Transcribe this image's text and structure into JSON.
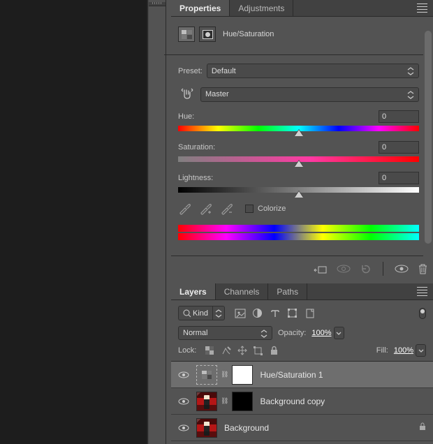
{
  "propertiesPanel": {
    "tabs": {
      "properties": "Properties",
      "adjustments": "Adjustments"
    },
    "adjustmentTitle": "Hue/Saturation",
    "presetLabel": "Preset:",
    "presetValue": "Default",
    "channelValue": "Master",
    "hue": {
      "label": "Hue:",
      "value": "0"
    },
    "saturation": {
      "label": "Saturation:",
      "value": "0"
    },
    "lightness": {
      "label": "Lightness:",
      "value": "0"
    },
    "colorizeLabel": "Colorize"
  },
  "layersPanel": {
    "tabs": {
      "layers": "Layers",
      "channels": "Channels",
      "paths": "Paths"
    },
    "filterLabel": "Kind",
    "blendMode": "Normal",
    "opacityLabel": "Opacity:",
    "opacityValue": "100%",
    "lockLabel": "Lock:",
    "fillLabel": "Fill:",
    "fillValue": "100%",
    "layers": [
      {
        "name": "Hue/Saturation 1"
      },
      {
        "name": "Background copy"
      },
      {
        "name": "Background"
      }
    ]
  }
}
